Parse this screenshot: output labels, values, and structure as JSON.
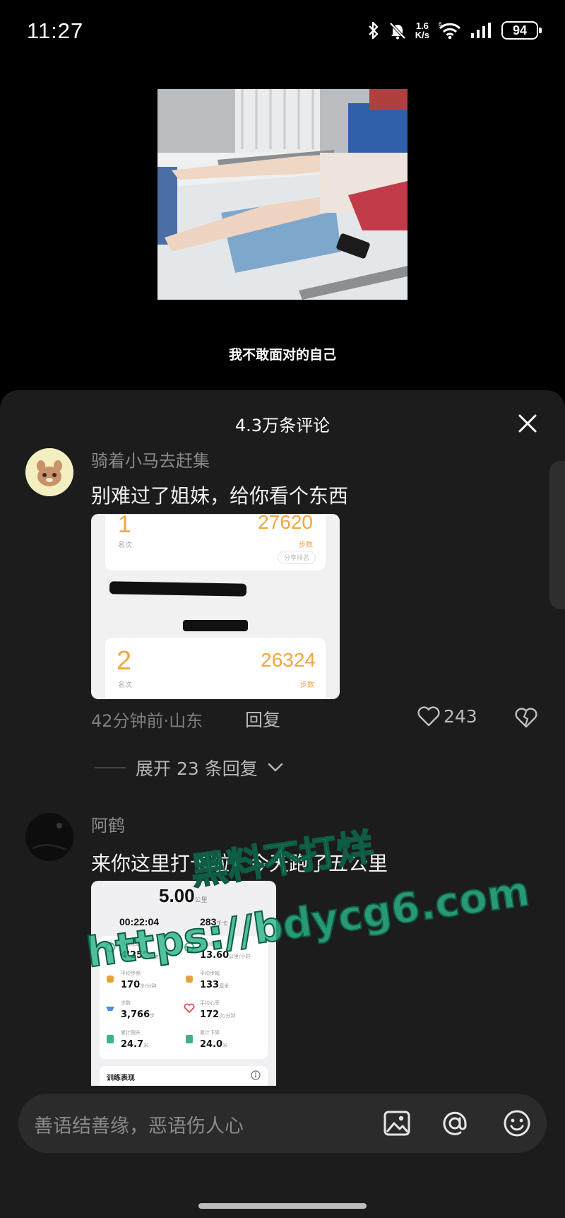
{
  "status_bar": {
    "time": "11:27",
    "net_speed_value": "1.6",
    "net_speed_unit": "K/s",
    "battery": "94"
  },
  "post": {
    "caption": "我不敢面对的自己"
  },
  "comments_sheet": {
    "title": "4.3万条评论",
    "comments": [
      {
        "username": "骑着小马去赶集",
        "text": "别难过了姐妹，给你看个东西",
        "image": {
          "top_partial_value": "27620",
          "top_label": "步数",
          "top_rank": "1",
          "top_rank_label": "名次",
          "share_hint": "分享排名",
          "rank": "2",
          "rank_label": "名次",
          "steps": "26324",
          "steps_label": "步数"
        },
        "time_location": "42分钟前·山东",
        "reply_label": "回复",
        "likes": "243"
      },
      {
        "username": "阿鹤",
        "text": "来你这里打卡啦，今天跑了五公里",
        "image": {
          "distance": "5.00",
          "distance_unit": "公里",
          "duration": "00:22:04",
          "calories": "283",
          "calories_unit": "千卡",
          "pace_label": "平均配速",
          "pace": "4'25\"",
          "pace_unit": "/公里",
          "speed_label": "平均速度",
          "speed": "13.60",
          "speed_unit": "公里/小时",
          "cadence_label": "平均步频",
          "cadence": "170",
          "cadence_unit": "步/分钟",
          "stride_label": "平均步幅",
          "stride": "133",
          "stride_unit": "厘米",
          "steps_label": "步数",
          "steps": "3,766",
          "steps_unit": "步",
          "heart_label": "平均心率",
          "heart": "172",
          "heart_unit": "次/分钟",
          "ascent_label": "累计爬升",
          "ascent": "24.7",
          "ascent_unit": "米",
          "descent_label": "累计下降",
          "descent": "24.0",
          "descent_unit": "米",
          "section_title": "训练表现"
        }
      }
    ],
    "expand_replies": "展开 23 条回复"
  },
  "watermark": {
    "line1": "黑料不打烊",
    "line2": "https://bdycg6.com"
  },
  "input_bar": {
    "placeholder": "善语结善缘，恶语伤人心"
  },
  "colors": {
    "background": "#000000",
    "sheet": "#1c1c1c",
    "input": "#2b2b2b",
    "watermark": "#2bb38a",
    "steps_orange": "#f0a640"
  }
}
